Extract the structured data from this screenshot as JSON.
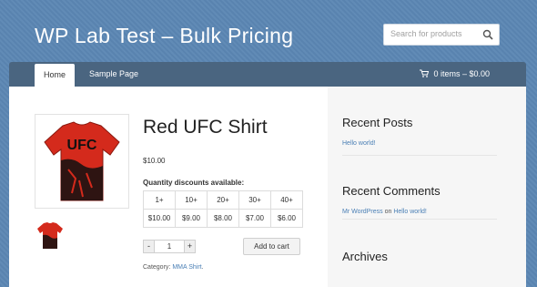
{
  "site": {
    "title": "WP Lab Test – Bulk Pricing"
  },
  "search": {
    "placeholder": "Search for products"
  },
  "nav": {
    "items": [
      {
        "label": "Home"
      },
      {
        "label": "Sample Page"
      }
    ]
  },
  "cart": {
    "label": "0 items – $0.00"
  },
  "product": {
    "title": "Red UFC Shirt",
    "price": "$10.00",
    "discount_label": "Quantity discounts available:",
    "tiers": [
      "1+",
      "10+",
      "20+",
      "30+",
      "40+"
    ],
    "tier_prices": [
      "$10.00",
      "$9.00",
      "$8.00",
      "$7.00",
      "$6.00"
    ],
    "quantity": "1",
    "qty_minus": "-",
    "qty_plus": "+",
    "add_to_cart": "Add to cart",
    "category_label": "Category:",
    "category_link": "MMA Shirt",
    "category_suffix": ".",
    "image_text": "UFC",
    "colors": {
      "shirt": "#d42a1c",
      "print": "#111111"
    }
  },
  "sidebar": {
    "recent_posts_title": "Recent Posts",
    "recent_post": "Hello world!",
    "recent_comments_title": "Recent Comments",
    "comment_author": "Mr WordPress",
    "comment_on": "on",
    "comment_post": "Hello world!",
    "archives_title": "Archives"
  },
  "colors": {
    "background": "#5b86b3",
    "navbar": "#4a6580",
    "link": "#4a7fb5"
  }
}
